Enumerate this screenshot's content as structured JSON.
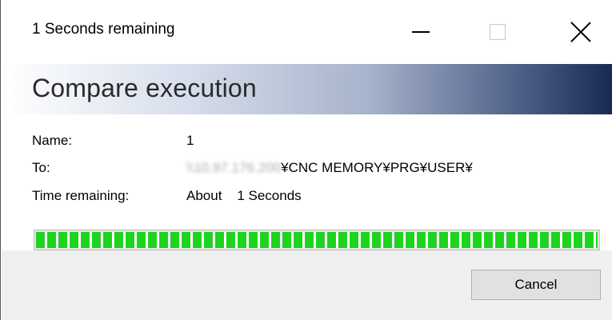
{
  "window": {
    "title": "1 Seconds remaining",
    "controls": {
      "minimize_icon": "minimize-icon",
      "maximize_icon": "maximize-icon",
      "close_icon": "close-icon"
    }
  },
  "header": {
    "title": "Compare execution",
    "gradient_start": "#ffffff",
    "gradient_end": "#172a52"
  },
  "info": {
    "name_label": "Name:",
    "name_value": "1",
    "to_label": "To:",
    "to_host_blurred": "\\\\10.97.176.200",
    "to_path": "¥CNC MEMORY¥PRG¥USER¥",
    "time_label": "Time remaining:",
    "time_value": "About    1 Seconds"
  },
  "progress": {
    "fraction": 1.0,
    "color": "#1ed31e"
  },
  "footer": {
    "cancel_label": "Cancel"
  }
}
